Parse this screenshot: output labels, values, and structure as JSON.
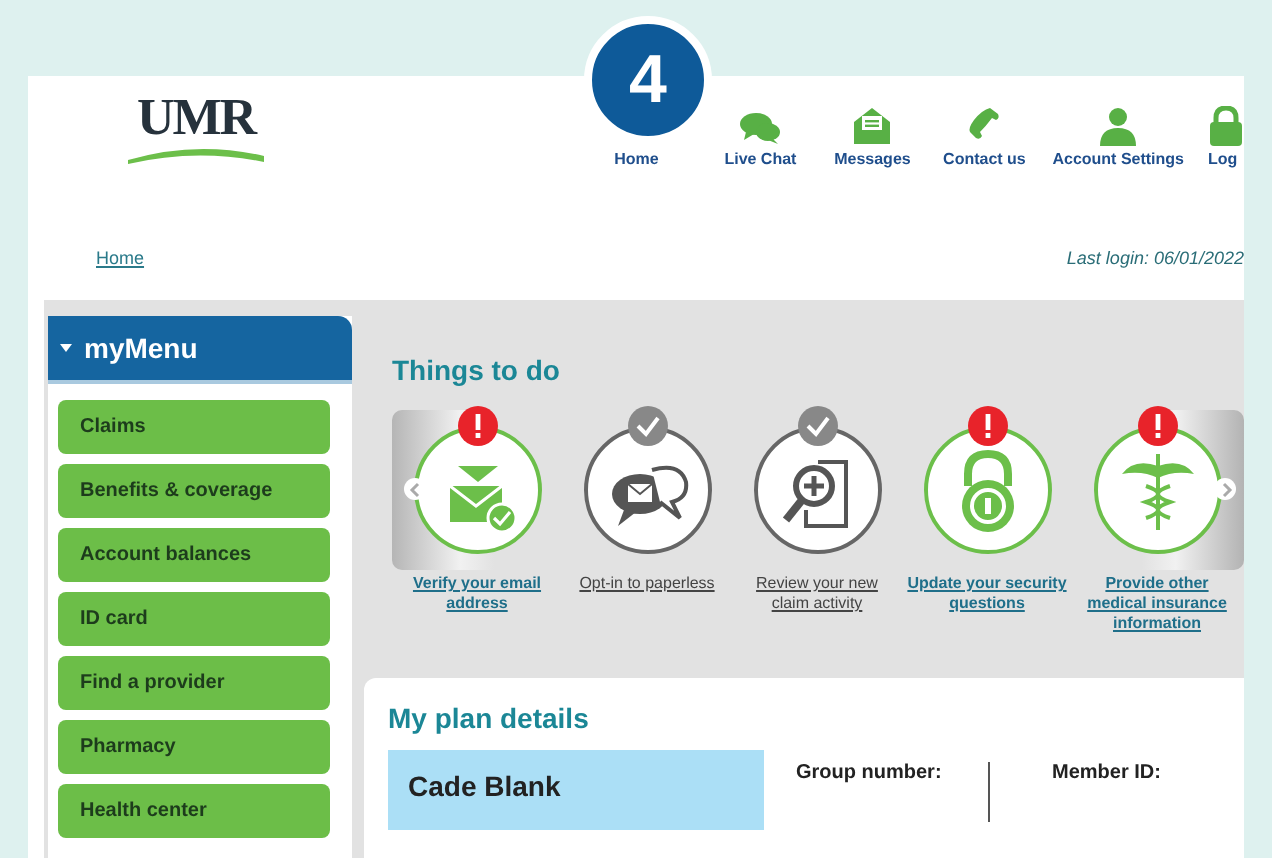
{
  "step_badge": "4",
  "logo": "UMR",
  "nav": [
    {
      "label": "Home",
      "kind": "home"
    },
    {
      "label": "Live Chat",
      "kind": "chat"
    },
    {
      "label": "Messages",
      "kind": "messages"
    },
    {
      "label": "Contact us",
      "kind": "phone"
    },
    {
      "label": "Account Settings",
      "kind": "account"
    },
    {
      "label": "Log",
      "kind": "lock"
    }
  ],
  "breadcrumb": "Home",
  "last_login": "Last login: 06/01/2022",
  "sidebar": {
    "title": "myMenu",
    "expanded": true,
    "items": [
      "Claims",
      "Benefits & coverage",
      "Account balances",
      "ID card",
      "Find a provider",
      "Pharmacy",
      "Health center"
    ]
  },
  "things_to_do": {
    "title": "Things to do",
    "tasks": [
      {
        "label": "Verify your email address",
        "kind": "email",
        "completed": false
      },
      {
        "label": "Opt-in to paperless",
        "kind": "paperless",
        "completed": true
      },
      {
        "label": "Review your new claim activity",
        "kind": "claim",
        "completed": true
      },
      {
        "label": "Update your security questions",
        "kind": "security",
        "completed": false
      },
      {
        "label": "Provide other medical insurance information",
        "kind": "medical",
        "completed": false
      }
    ]
  },
  "plan_details": {
    "title": "My plan details",
    "member_name": "Cade Blank",
    "fields": [
      {
        "label": "Group number:"
      },
      {
        "label": "Member ID:"
      }
    ]
  }
}
